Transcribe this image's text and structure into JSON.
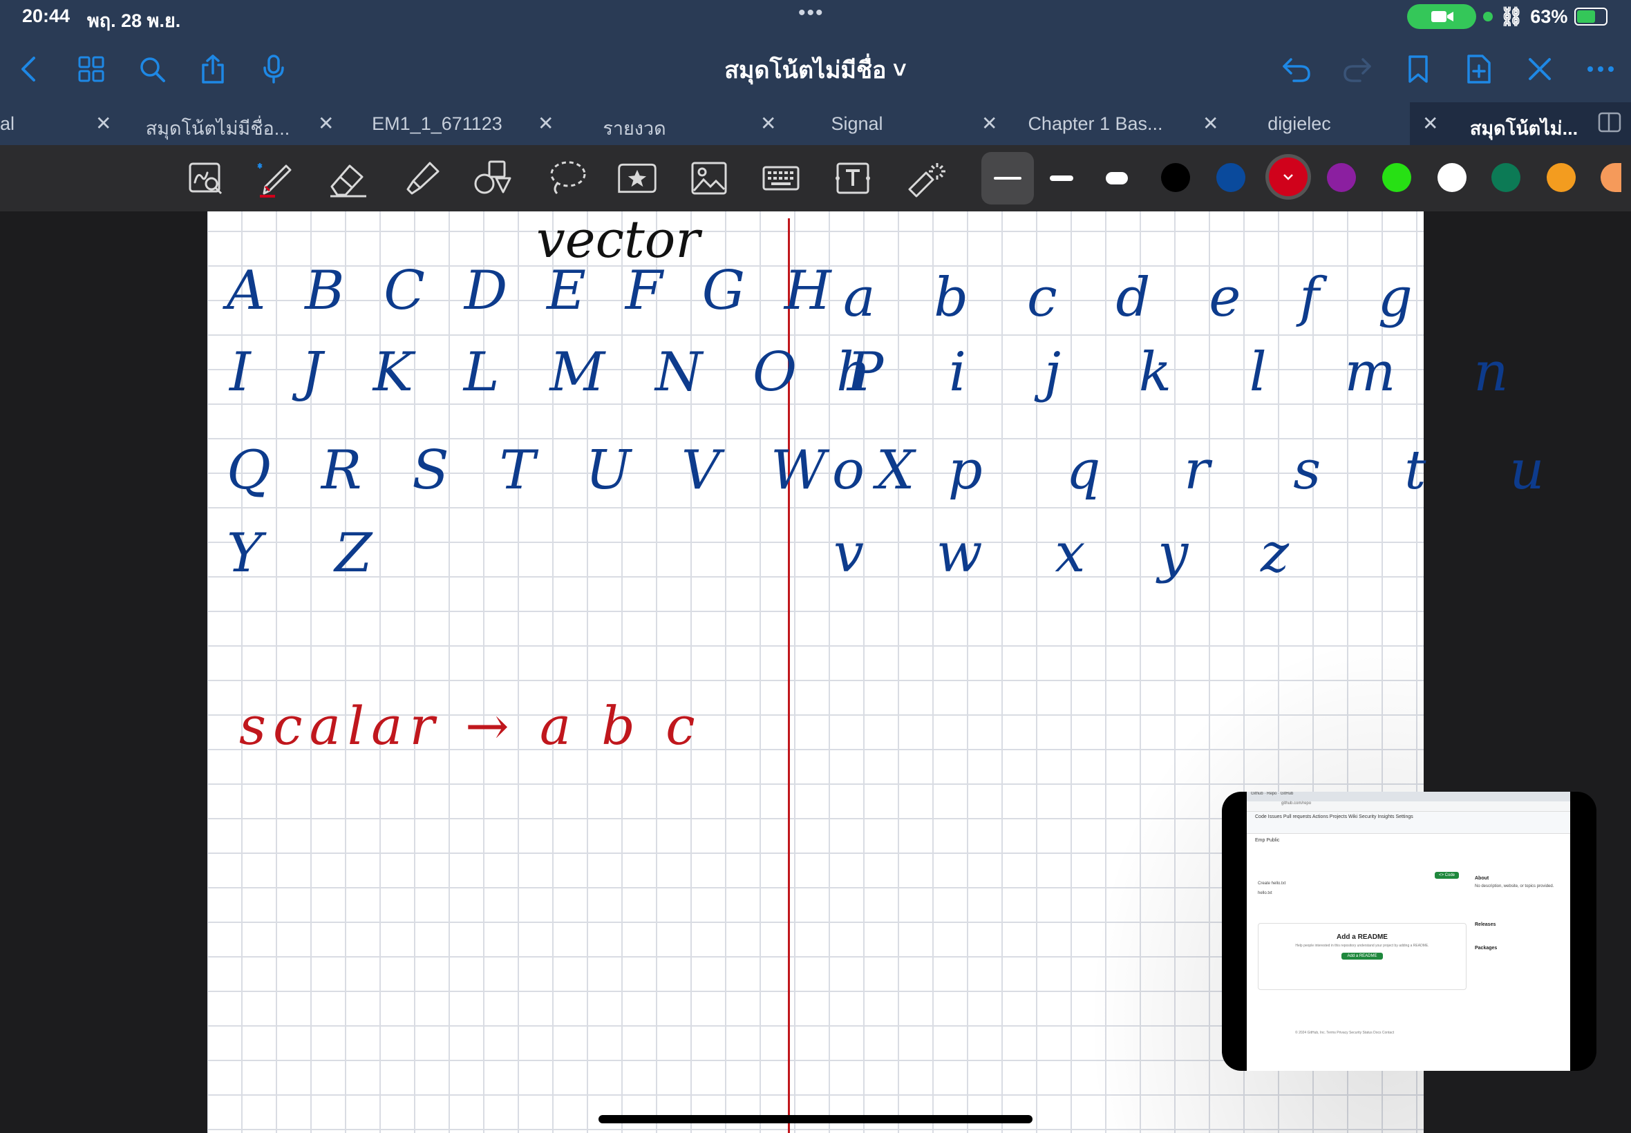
{
  "status": {
    "time": "20:44",
    "date": "พฤ. 28 พ.ย.",
    "battery": "63%",
    "dots": "•••"
  },
  "nav": {
    "title": "สมุดโน้ตไม่มีชื่อ ˅"
  },
  "tabs": [
    {
      "label": "al"
    },
    {
      "label": "สมุดโน้ตไม่มีชื่อ..."
    },
    {
      "label": "EM1_1_671123"
    },
    {
      "label": "รายงวด"
    },
    {
      "label": "Signal"
    },
    {
      "label": "Chapter 1 Bas..."
    },
    {
      "label": "digielec"
    },
    {
      "label": "สมุดโน้ตไม่..."
    }
  ],
  "tab_close": "✕",
  "colors": {
    "accent": "#1e88e5",
    "ink_blue": "#0d3b8c",
    "ink_red": "#c0171d",
    "bar": "#2a3b55"
  },
  "swatches": [
    "#000000",
    "#0a4a9c",
    "#d0021b",
    "#8b1fa0",
    "#27e014",
    "#ffffff",
    "#0c7a55",
    "#f39c1f",
    "#f59a5a"
  ],
  "notes": {
    "title_word": "vector",
    "upper_row1": "A B C D E F G H",
    "upper_row2": "I J K L M N O P",
    "upper_row3": "Q R S T U V W X",
    "upper_row4": "Y Z",
    "lower_row1": "a b c d e f g",
    "lower_row2": "h i j k l m n",
    "lower_row3": "o p q r s t u",
    "lower_row4": "v w x y z",
    "scalar_line": "scalar → a b c"
  },
  "pip": {
    "tabs_text": "Github · Repo · GitHub",
    "address": "github.com/repo",
    "nav_items": "Code  Issues  Pull requests  Actions  Projects  Wiki  Security  Insights  Settings",
    "repo_name": "Emp  Public",
    "code_button": "<> Code",
    "file_row1": "Create hello.txt",
    "file_row2": "hello.txt",
    "readme_title": "Add a README",
    "readme_sub": "Help people interested in this repository understand your project by adding a README.",
    "readme_button": "Add a README",
    "about": "About",
    "about_text": "No description, website, or topics provided.",
    "releases": "Releases",
    "packages": "Packages",
    "footer": "© 2024 GitHub, Inc.  Terms  Privacy  Security  Status  Docs  Contact"
  }
}
